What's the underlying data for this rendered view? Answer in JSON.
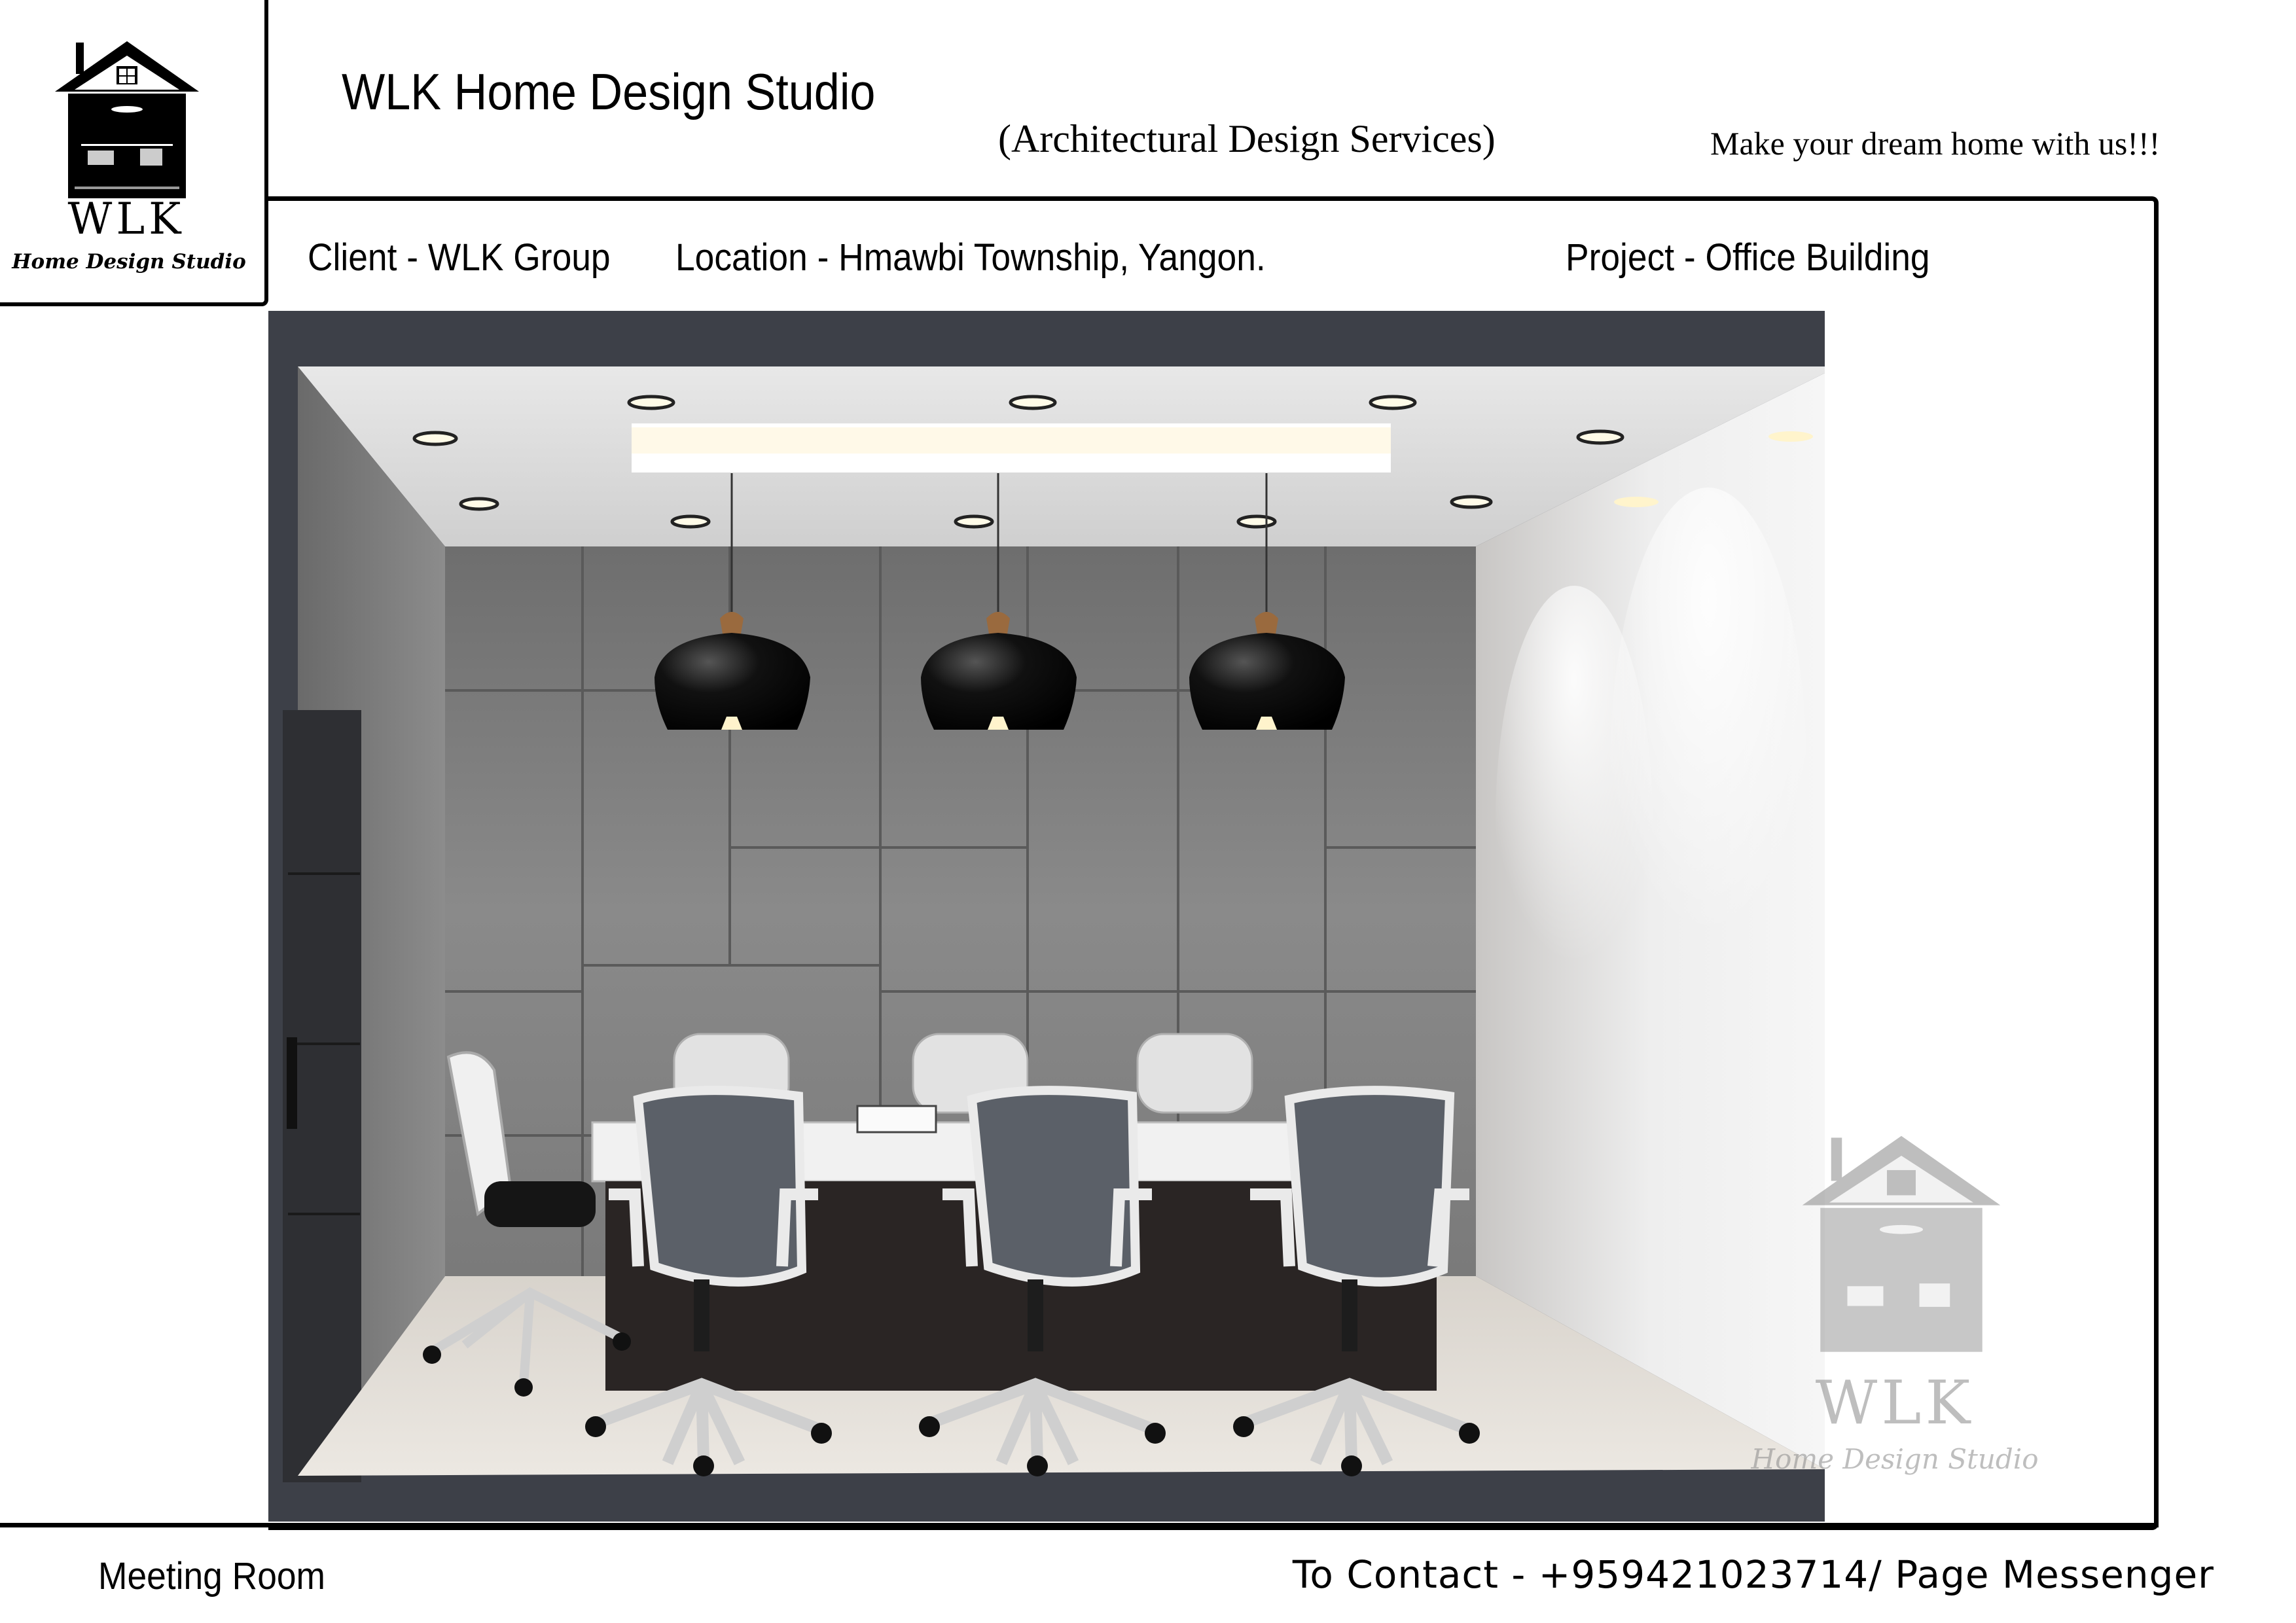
{
  "logo": {
    "icon": "house-icon",
    "name": "WLK",
    "subtitle": "Home Design Studio"
  },
  "header": {
    "studio_title": "WLK Home Design Studio",
    "services": "(Architectural Design Services)",
    "tagline": "Make your dream home with us!!!"
  },
  "info": {
    "client": "Client - WLK Group",
    "location": "Location - Hmawbi Township, Yangon.",
    "project": "Project - Office Building"
  },
  "render": {
    "description_icon": "meeting-room-render",
    "pendant_lamps": 3,
    "chairs": 7
  },
  "watermark": {
    "icon": "house-icon",
    "name": "WLK",
    "subtitle": "Home Design Studio"
  },
  "footer": {
    "room_name": "Meeting Room",
    "contact": "To Contact - +959421023714/ Page Messenger"
  }
}
